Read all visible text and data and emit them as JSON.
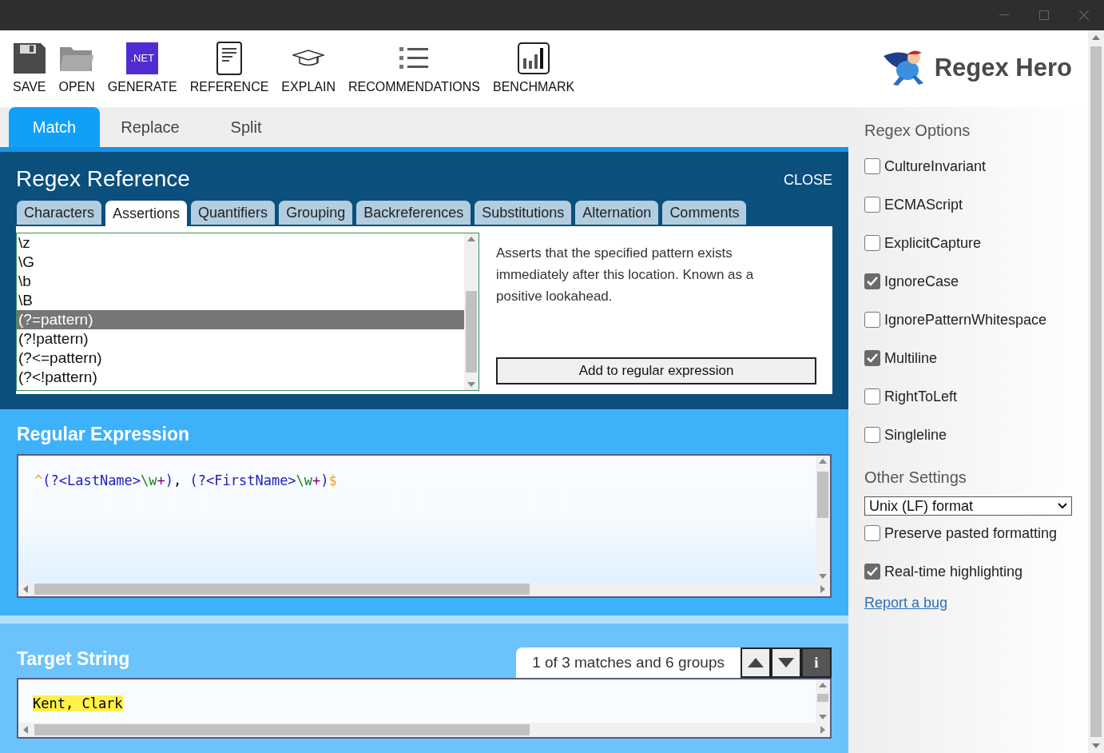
{
  "toolbar": [
    {
      "label": "SAVE",
      "kind": "save"
    },
    {
      "label": "OPEN",
      "kind": "open"
    },
    {
      "label": "GENERATE",
      "kind": "generate",
      "badge": ".NET"
    },
    {
      "label": "REFERENCE",
      "kind": "reference"
    },
    {
      "label": "EXPLAIN",
      "kind": "explain"
    },
    {
      "label": "RECOMMENDATIONS",
      "kind": "recommendations"
    },
    {
      "label": "BENCHMARK",
      "kind": "benchmark"
    }
  ],
  "logo": {
    "title": "Regex Hero"
  },
  "mode_tabs": [
    {
      "label": "Match",
      "selected": true
    },
    {
      "label": "Replace",
      "selected": false
    },
    {
      "label": "Split",
      "selected": false
    }
  ],
  "reference": {
    "title": "Regex Reference",
    "close": "CLOSE",
    "tabs": [
      {
        "label": "Characters",
        "selected": false
      },
      {
        "label": "Assertions",
        "selected": true
      },
      {
        "label": "Quantifiers",
        "selected": false
      },
      {
        "label": "Grouping",
        "selected": false
      },
      {
        "label": "Backreferences",
        "selected": false
      },
      {
        "label": "Substitutions",
        "selected": false
      },
      {
        "label": "Alternation",
        "selected": false
      },
      {
        "label": "Comments",
        "selected": false
      }
    ],
    "items": [
      {
        "label": "\\z",
        "selected": false
      },
      {
        "label": "\\G",
        "selected": false
      },
      {
        "label": "\\b",
        "selected": false
      },
      {
        "label": "\\B",
        "selected": false
      },
      {
        "label": "(?=pattern)",
        "selected": true
      },
      {
        "label": "(?!pattern)",
        "selected": false
      },
      {
        "label": "(?<=pattern)",
        "selected": false
      },
      {
        "label": "(?<!pattern)",
        "selected": false
      }
    ],
    "description": "Asserts that the specified pattern exists immediately after this location. Known as a positive lookahead.",
    "add_button": "Add to regular expression"
  },
  "regex": {
    "title": "Regular Expression",
    "tokens": [
      {
        "text": "^",
        "kind": "anchor"
      },
      {
        "text": "(?<LastName>",
        "kind": "group"
      },
      {
        "text": "\\w",
        "kind": "class"
      },
      {
        "text": "+",
        "kind": "quantifier"
      },
      {
        "text": ")",
        "kind": "group"
      },
      {
        "text": ", ",
        "kind": "literal"
      },
      {
        "text": "(?<FirstName>",
        "kind": "group"
      },
      {
        "text": "\\w",
        "kind": "class"
      },
      {
        "text": "+",
        "kind": "quantifier"
      },
      {
        "text": ")",
        "kind": "group"
      },
      {
        "text": "$",
        "kind": "anchor"
      }
    ]
  },
  "target": {
    "title": "Target String",
    "status": "1 of 3 matches and 6 groups",
    "info_button": "i",
    "lines": [
      {
        "text": "Kent, Clark",
        "highlighted": true
      }
    ]
  },
  "options": {
    "title": "Regex Options",
    "items": [
      {
        "label": "CultureInvariant",
        "checked": false
      },
      {
        "label": "ECMAScript",
        "checked": false
      },
      {
        "label": "ExplicitCapture",
        "checked": false
      },
      {
        "label": "IgnoreCase",
        "checked": true
      },
      {
        "label": "IgnorePatternWhitespace",
        "checked": false
      },
      {
        "label": "Multiline",
        "checked": true
      },
      {
        "label": "RightToLeft",
        "checked": false
      },
      {
        "label": "Singleline",
        "checked": false
      }
    ]
  },
  "other_settings": {
    "title": "Other Settings",
    "select": "Unix (LF) format",
    "items": [
      {
        "label": "Preserve pasted formatting",
        "checked": false
      },
      {
        "label": "Real-time highlighting",
        "checked": true
      }
    ],
    "link": "Report a bug"
  }
}
